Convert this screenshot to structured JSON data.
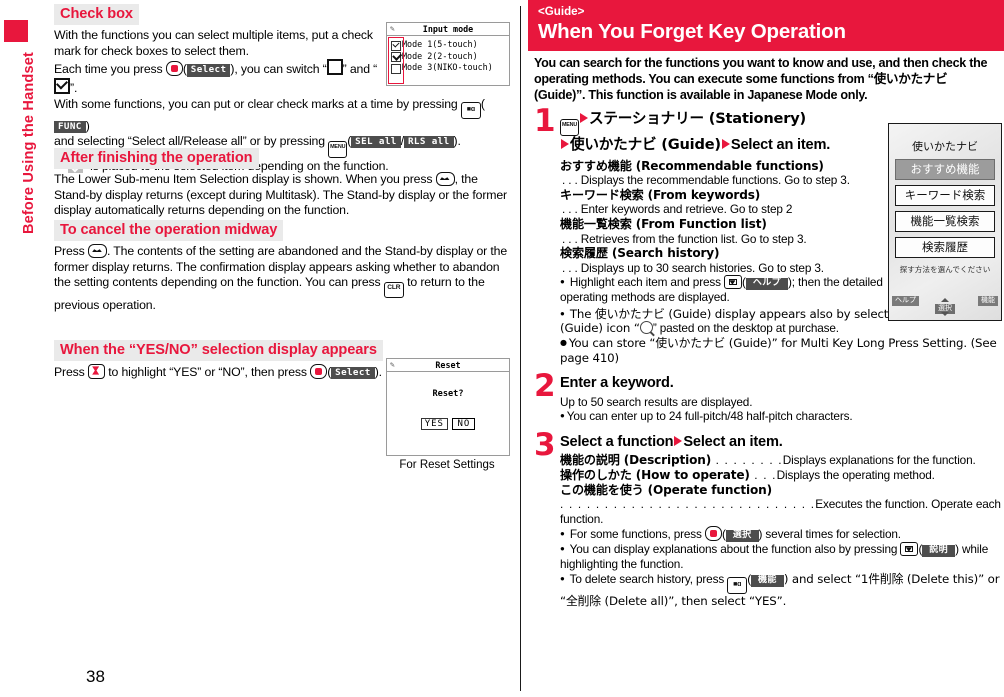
{
  "page_number": "38",
  "side_tab": {
    "label": "Before Using the Handset",
    "color": "#e8173d"
  },
  "left_column": {
    "sections": [
      {
        "heading": "Check box",
        "paragraph_1": "With the functions you can select multiple items, put a check mark for check boxes to select them.",
        "paragraph_2_a": "Each time you press",
        "paragraph_2_key_label": "Select",
        "paragraph_2_b": "), you can switch “",
        "paragraph_2_c": "” and “",
        "paragraph_2_d": "”.",
        "paragraph_3_a": "With some functions, you can put or clear check marks at a time by pressing",
        "paragraph_3_func": "FUNC",
        "paragraph_3_b": "and selecting “Select all/Release all” or by pressing",
        "paragraph_3_sel_all": "SEL all",
        "paragraph_3_slash": "/",
        "paragraph_3_rls_all": "RLS all",
        "paragraph_3_c": ").",
        "bullet_a": "“",
        "bullet_b": "” is placed to the selected item depending on the function."
      },
      {
        "heading": "After finishing the operation",
        "paragraph_a": "The Lower Sub-menu Item Selection display is shown. When you press",
        "paragraph_b": ", the Stand-by display returns (except during Multitask). The Stand-by display or the former display automatically returns depending on the function."
      },
      {
        "heading": "To cancel the operation midway",
        "paragraph_a": "Press",
        "paragraph_b": ". The contents of the setting are abandoned and the Stand-by display or the former display returns. The confirmation display appears asking whether to abandon the setting contents depending on the function. You can press",
        "paragraph_c": "to return to the previous operation."
      },
      {
        "heading": "When the “YES/NO” selection display appears",
        "paragraph_a": "Press",
        "paragraph_b": "to highlight “YES” or “NO”, then press",
        "paragraph_key_label": "Select",
        "paragraph_c": ")."
      }
    ],
    "screenshot_input_mode": {
      "title": "Input mode",
      "rows": [
        {
          "label": "Mode 1(5-touch)",
          "check": "check"
        },
        {
          "label": "Mode 2(2-touch)",
          "check": "solid"
        },
        {
          "label": "Mode 3(NIKO-touch)",
          "check": "empty"
        }
      ]
    },
    "screenshot_reset": {
      "title": "Reset",
      "prompt": "Reset?",
      "yes_label": "YES",
      "no_label": "NO",
      "caption": "For Reset Settings"
    }
  },
  "right_column": {
    "banner": {
      "guide_tag": "<Guide>",
      "title": "When You Forget Key Operation"
    },
    "intro": "You can search for the functions you want to know and use, and then check the operating methods. You can execute some functions from “使いかたナビ (Guide)”. This function is available in Japanese Mode only.",
    "steps": [
      {
        "number": "1",
        "title_a": "ステーショナリー (Stationery)",
        "title_b": "使いかたナビ (Guide)",
        "title_c": "Select an item.",
        "defs": [
          {
            "term": "おすすめ機能 (Recommendable functions)",
            "desc": ". . . Displays the recommendable functions. Go to step 3."
          },
          {
            "term": "キーワード検索 (From keywords)",
            "desc": ". . . Enter keywords and retrieve. Go to step 2"
          },
          {
            "term": "機能一覧検索 (From Function list)",
            "desc": ". . . Retrieves from the function list. Go to step 3."
          },
          {
            "term": "検索履歴 (Search history)",
            "desc": ". . . Displays up to 30 search histories. Go to step 3."
          }
        ],
        "bullets": [
          {
            "a": "Highlight each item and press",
            "key_label": "ヘルプ",
            "b": "); then the detailed operating methods are displayed."
          },
          {
            "a": "The 使いかたナビ (Guide) display appears also by selecting the 使いかたナビ (Guide) icon “",
            "b": "” pasted on the desktop at purchase."
          },
          {
            "a": "You can store “使いかたナビ (Guide)” for Multi Key Long Press Setting. (See page 410)"
          }
        ]
      },
      {
        "number": "2",
        "title_c": "Enter a keyword.",
        "body": "Up to 50 search results are displayed.",
        "bullets": [
          {
            "a": "You can enter up to 24 full-pitch/48 half-pitch characters."
          }
        ]
      },
      {
        "number": "3",
        "title_c": "Select a function",
        "title_d": "Select an item.",
        "defs": [
          {
            "term": "機能の説明 (Description)",
            "dots": " . . . . . . . .",
            "desc": "Displays explanations for the function."
          },
          {
            "term": "操作のしかた (How to operate)",
            "dots": " . . .",
            "desc": "Displays the operating method."
          },
          {
            "term": "この機能を使う (Operate function)",
            "dots": ". . . . . . . . . . . . . . . . . . . . . . . . . . . . .",
            "desc": "Executes the function. Operate each function."
          }
        ],
        "bullets": [
          {
            "a": "For some functions, press",
            "key_label": "選択",
            "b": ") several times for selection."
          },
          {
            "a": "You can display explanations about the function also by pressing",
            "key_label": "説明",
            "b": ") while highlighting the function."
          },
          {
            "a": "To delete search history, press",
            "key_label": "機能",
            "b": ") and select “1件削除 (Delete this)” or “全削除 (Delete all)”, then select “YES”."
          }
        ]
      }
    ],
    "phone_mock": {
      "title": "使いかたナビ",
      "items": [
        {
          "label": "おすすめ機能",
          "selected": true
        },
        {
          "label": "キーワード検索",
          "selected": false
        },
        {
          "label": "機能一覧検索",
          "selected": false
        },
        {
          "label": "検索履歴",
          "selected": false
        }
      ],
      "hint": "探す方法を選んでください",
      "softkey_left": "ヘルプ",
      "softkey_center": "選択",
      "softkey_right": "機能"
    }
  }
}
